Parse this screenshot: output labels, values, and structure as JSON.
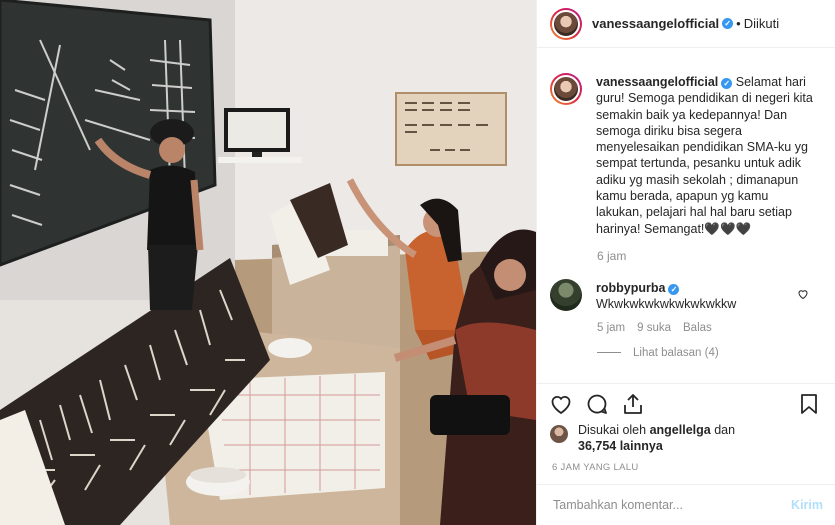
{
  "post": {
    "username": "vanessaangelofficial",
    "verified_mark": "✓",
    "separator": "•",
    "follow_status": "Diikuti"
  },
  "caption": {
    "username": "vanessaangelofficial",
    "text": "Selamat hari guru! Semoga pendidikan di negeri kita semakin baik ya kedepannya! Dan semoga diriku bisa segera menyelesaikan pendidikan SMA-ku yg sempat tertunda, pesanku untuk adik adiku yg masih sekolah ; dimanapun kamu berada, apapun yg kamu lakukan, pelajari hal hal baru setiap harinya! Semangat!🖤🖤🖤",
    "time": "6 jam"
  },
  "comments": [
    {
      "username": "robbypurba",
      "text": "Wkwkwkwkwkwkwkwkkw",
      "time": "5 jam",
      "likes": "9 suka",
      "reply": "Balas",
      "view_replies": "Lihat balasan (4)"
    }
  ],
  "likes": {
    "prefix": "Disukai oleh",
    "user": "angellelga",
    "middle": "dan",
    "count": "36,754 lainnya"
  },
  "timestamp": "6 JAM YANG LALU",
  "add_comment": {
    "placeholder": "Tambahkan komentar...",
    "post_label": "Kirim"
  },
  "icons": [
    "heart-icon",
    "comment-icon",
    "share-icon",
    "bookmark-icon"
  ],
  "colors": {
    "verified": "#3897f0",
    "meta": "#8e8e8e",
    "post_disabled": "#b2dffc"
  }
}
